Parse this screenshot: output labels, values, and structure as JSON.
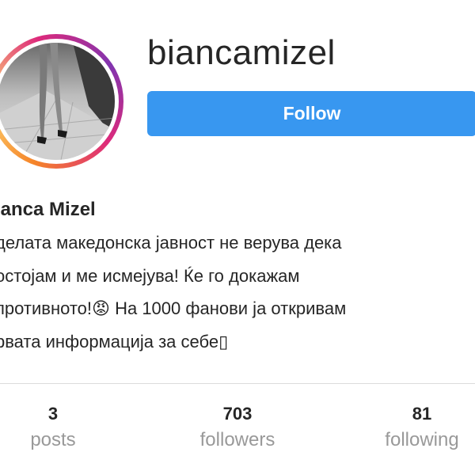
{
  "profile": {
    "username": "biancamizel",
    "full_name": "ianca Mizel",
    "follow_label": "Follow",
    "bio": "делата македонска јавност не верува дека\nостојам и ме исмејува! Ќе го докажам\nпротивното!😡 На 1000 фанови ја откривам\nрвата информација за себе▯"
  },
  "stats": [
    {
      "value": "3",
      "label": "posts"
    },
    {
      "value": "703",
      "label": "followers"
    },
    {
      "value": "81",
      "label": "following"
    }
  ],
  "colors": {
    "follow_button": "#3897f0",
    "text_primary": "#262626",
    "text_secondary": "#999999",
    "divider": "#dbdbdb"
  },
  "avatar": {
    "description_icon": "profile-photo"
  }
}
